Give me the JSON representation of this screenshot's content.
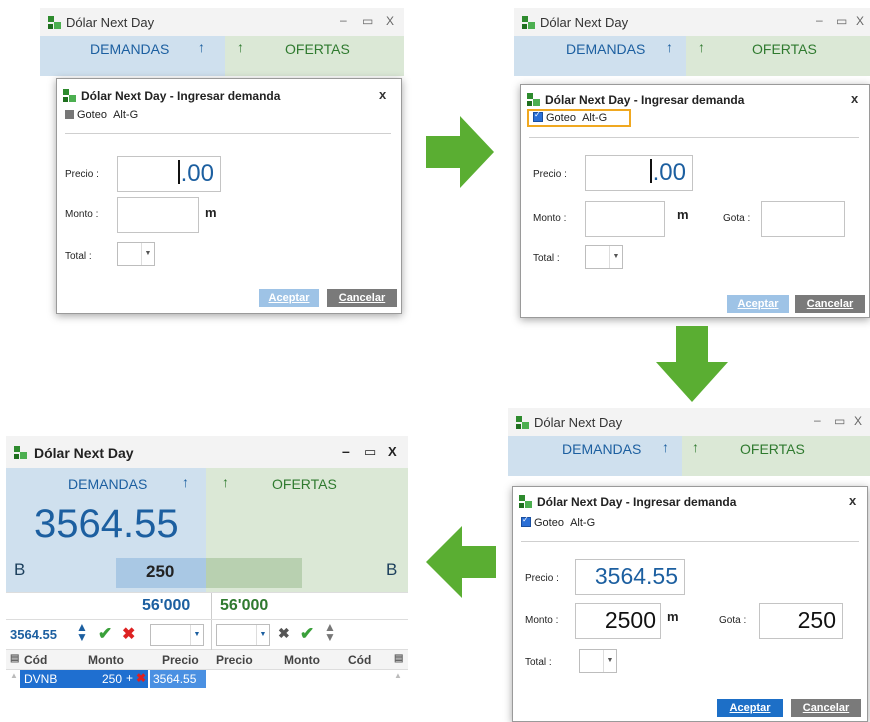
{
  "window": {
    "title": "Dólar Next Day"
  },
  "market": {
    "demandas": "DEMANDAS",
    "ofertas": "OFERTAS",
    "up_arrow": "↑"
  },
  "dialog": {
    "title": "Dólar Next Day - Ingresar demanda",
    "close": "x",
    "goteo_label": "Goteo",
    "goteo_shortcut": "Alt-G",
    "precio_label": "Precio :",
    "monto_label": "Monto :",
    "gota_label": "Gota :",
    "total_label": "Total :",
    "unit_m": "m",
    "precio_empty": ".00",
    "precio_value": "3564.55",
    "monto_value": "2500",
    "gota_value": "250",
    "aceptar": "Aceptar",
    "cancelar": "Cancelar"
  },
  "result": {
    "price": "3564.55",
    "b_left": "B",
    "b_right": "B",
    "qty": "250",
    "vol_dem": "56'000",
    "vol_ofe": "56'000",
    "order_price": "3564.55",
    "columns_left": [
      "Cód",
      "Monto",
      "Precio"
    ],
    "columns_right": [
      "Precio",
      "Monto",
      "Cód"
    ],
    "row": {
      "cod": "DVNB",
      "monto": "250",
      "plus": "+",
      "precio": "3564.55"
    }
  },
  "colors": {
    "arrow_green": "#5aae32",
    "blue_accent": "#1c5fa0",
    "green_accent": "#2f7a2f"
  }
}
